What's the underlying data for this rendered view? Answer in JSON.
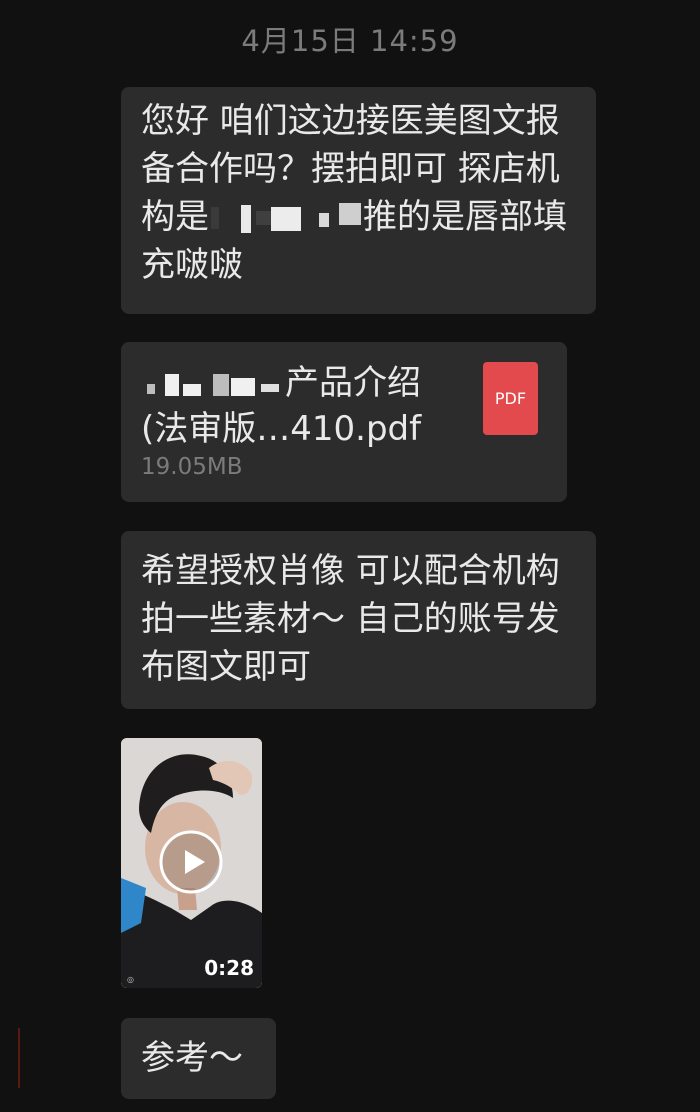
{
  "header": {
    "timestamp": "4月15日 14:59"
  },
  "messages": [
    {
      "type": "text",
      "text_before": "您好 咱们这边接医美图文报备合作吗？摆拍即可 探店机构是",
      "text_after": "推的是唇部填充啵啵"
    },
    {
      "type": "file",
      "name_visible": "产品介绍(法审版…410.pdf",
      "name_part1": "产品介绍",
      "name_part2": "(法审版…410.pdf",
      "size": "19.05MB",
      "icon": "pdf-icon",
      "icon_label": "PDF"
    },
    {
      "type": "text",
      "text": "希望授权肖像 可以配合机构拍一些素材～ 自己的账号发布图文即可"
    },
    {
      "type": "video",
      "duration": "0:28",
      "icon": "play-icon"
    },
    {
      "type": "text",
      "text": "参考～"
    }
  ],
  "colors": {
    "background": "#111111",
    "bubble": "#2c2c2c",
    "text": "#e9e9e9",
    "muted": "#7b7b7b",
    "pdf": "#e24a4e"
  }
}
